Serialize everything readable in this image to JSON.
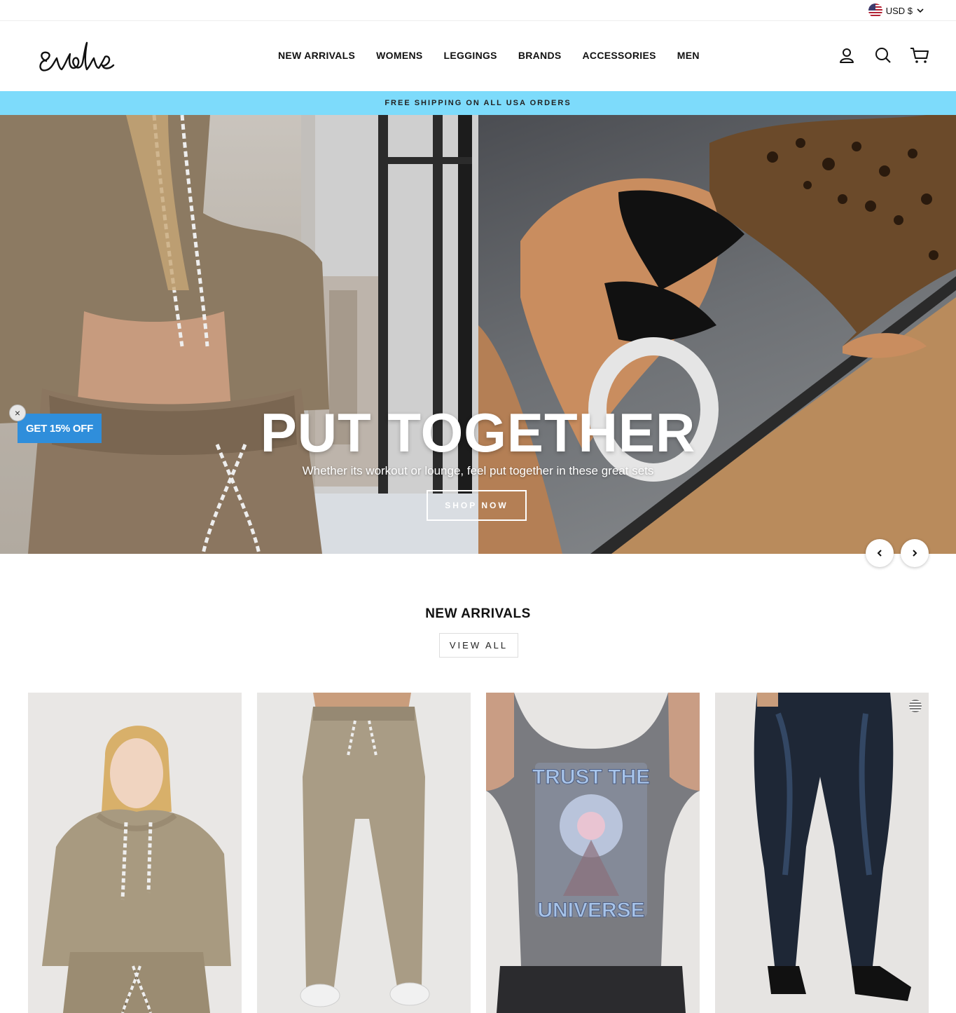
{
  "utility": {
    "currency_label": "USD $"
  },
  "header": {
    "brand": "evolve",
    "nav": [
      "NEW ARRIVALS",
      "WOMENS",
      "LEGGINGS",
      "BRANDS",
      "ACCESSORIES",
      "MEN"
    ]
  },
  "announcement": "FREE SHIPPING ON ALL USA ORDERS",
  "hero": {
    "title": "PUT TOGETHER",
    "subtitle": "Whether its workout or lounge, feel put together in these great sets",
    "button": "SHOP NOW"
  },
  "promo": {
    "label": "GET 15% OFF",
    "close": "×"
  },
  "new_arrivals": {
    "title": "NEW ARRIVALS",
    "view_all": "VIEW ALL",
    "products": [
      {
        "name": "cropped-velour-hoodie-card"
      },
      {
        "name": "velour-jogger-card"
      },
      {
        "name": "trust-the-universe-tank-card",
        "print_top": "TRUST THE",
        "print_bottom": "UNIVERSE"
      },
      {
        "name": "shine-legging-card"
      }
    ]
  },
  "colors": {
    "announcement_bg": "#7ddbfb",
    "promo_bg": "#2f8edb"
  }
}
